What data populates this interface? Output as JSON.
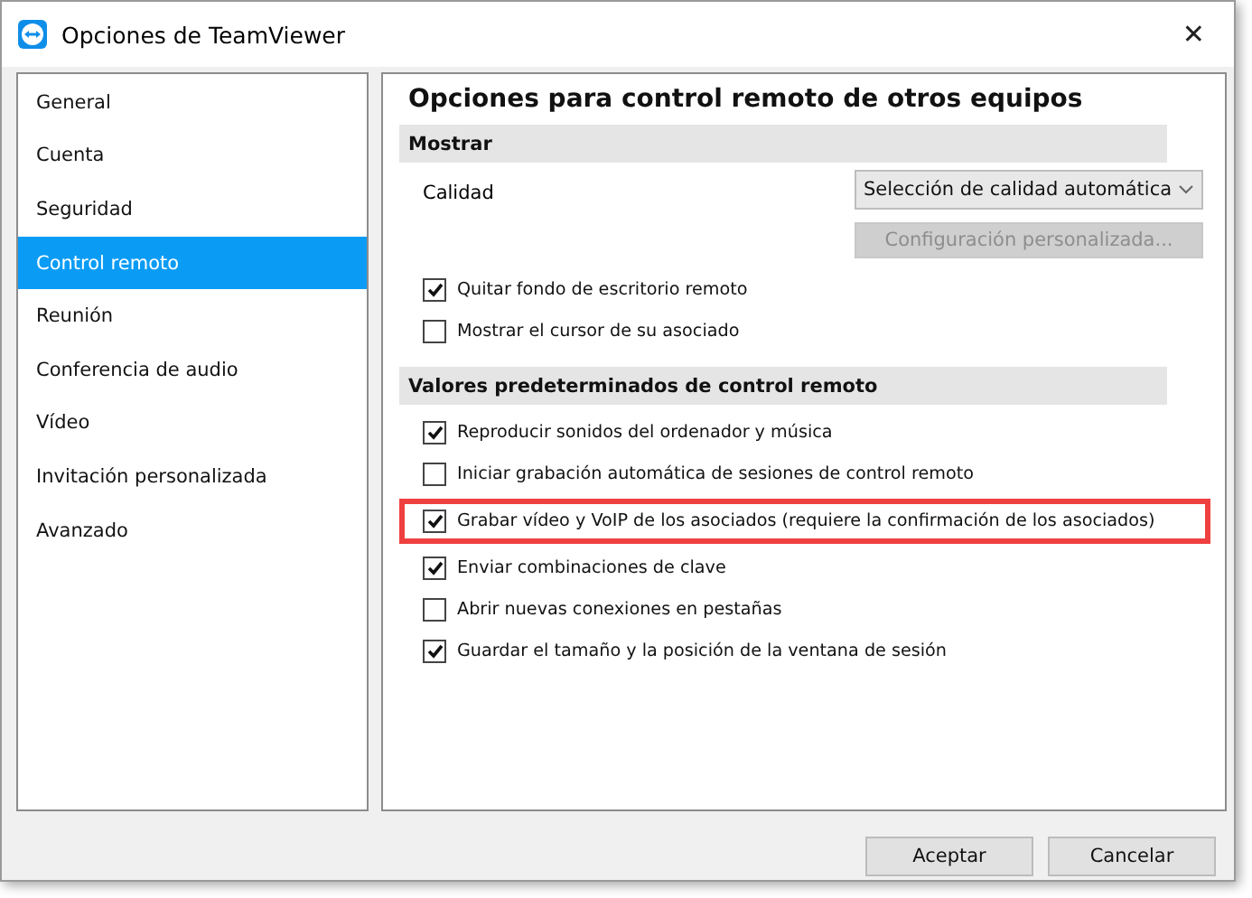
{
  "window": {
    "title": "Opciones de TeamViewer",
    "close": "✕"
  },
  "sidebar": {
    "items": [
      {
        "label": "General",
        "selected": false
      },
      {
        "label": "Cuenta",
        "selected": false
      },
      {
        "label": "Seguridad",
        "selected": false
      },
      {
        "label": "Control remoto",
        "selected": true
      },
      {
        "label": "Reunión",
        "selected": false
      },
      {
        "label": "Conferencia de audio",
        "selected": false
      },
      {
        "label": "Vídeo",
        "selected": false
      },
      {
        "label": "Invitación personalizada",
        "selected": false
      },
      {
        "label": "Avanzado",
        "selected": false
      }
    ]
  },
  "panel": {
    "title": "Opciones para control remoto de otros equipos",
    "sections": [
      {
        "header": "Mostrar",
        "quality": {
          "label": "Calidad",
          "value": "Selección de calidad automática",
          "button": {
            "label": "Configuración personalizada...",
            "disabled": true
          }
        },
        "options": [
          {
            "label": "Quitar fondo de escritorio remoto",
            "checked": true,
            "highlighted": false
          },
          {
            "label": "Mostrar el cursor de su asociado",
            "checked": false,
            "highlighted": false
          }
        ]
      },
      {
        "header": "Valores predeterminados de control remoto",
        "options": [
          {
            "label": "Reproducir sonidos del ordenador y música",
            "checked": true,
            "highlighted": false
          },
          {
            "label": "Iniciar grabación automática de sesiones de control remoto",
            "checked": false,
            "highlighted": false
          },
          {
            "label": "Grabar vídeo y VoIP de los asociados (requiere la confirmación de los asociados)",
            "checked": true,
            "highlighted": true
          },
          {
            "label": "Enviar combinaciones de clave",
            "checked": true,
            "highlighted": false
          },
          {
            "label": "Abrir nuevas conexiones en pestañas",
            "checked": false,
            "highlighted": false
          },
          {
            "label": "Guardar el tamaño y la posición de la ventana de sesión",
            "checked": true,
            "highlighted": false
          }
        ]
      }
    ]
  },
  "buttons": [
    "Aceptar",
    "Cancelar"
  ]
}
